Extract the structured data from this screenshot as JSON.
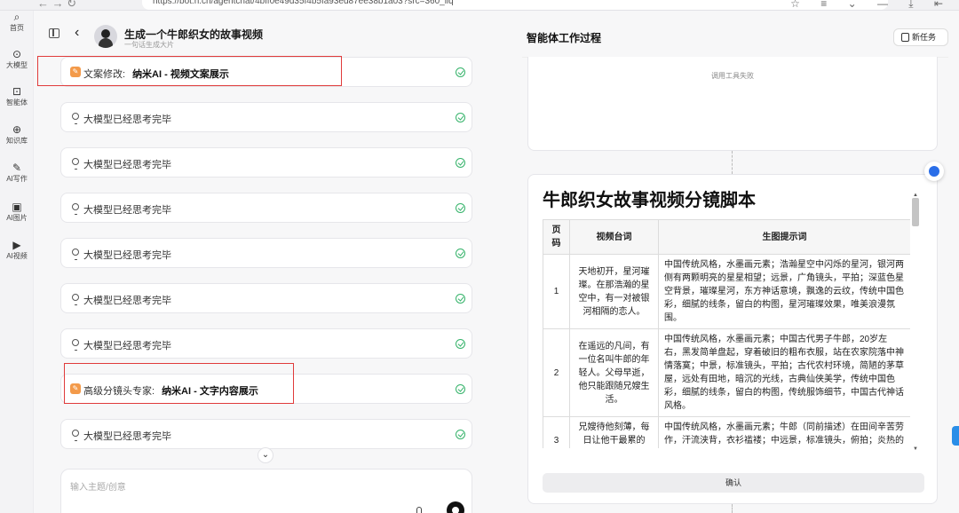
{
  "browser": {
    "nav": "← → ↻",
    "url": "https://bot.n.cn/agentchat/4bff0e49d35f4b5fa93ed87ee38b1a03?src=360_llq",
    "tools": "☆ ≡ ⌄ — ⤓ ⇤"
  },
  "sidebar": {
    "items": [
      {
        "label": "首页",
        "icon": "search-icon",
        "glyph": "⌕"
      },
      {
        "label": "大模型",
        "icon": "model-icon",
        "glyph": "⊙"
      },
      {
        "label": "智能体",
        "icon": "agent-icon",
        "glyph": "⊡"
      },
      {
        "label": "知识库",
        "icon": "knowledge-icon",
        "glyph": "⊕"
      },
      {
        "label": "AI写作",
        "icon": "pen-icon",
        "glyph": "✎"
      },
      {
        "label": "AI图片",
        "icon": "image-icon",
        "glyph": "▣"
      },
      {
        "label": "AI视频",
        "icon": "video-icon",
        "glyph": "▶"
      }
    ]
  },
  "chat": {
    "title": "生成一个牛郎织女的故事视频",
    "subtitle": "一句话生成大片",
    "back": "‹",
    "cards": [
      {
        "type": "tool",
        "prefix": "文案修改:",
        "detail": "纳米AI - 视频文案展示"
      },
      {
        "type": "thinking",
        "text": "大模型已经思考完毕"
      },
      {
        "type": "thinking",
        "text": "大模型已经思考完毕"
      },
      {
        "type": "thinking",
        "text": "大模型已经思考完毕"
      },
      {
        "type": "thinking",
        "text": "大模型已经思考完毕"
      },
      {
        "type": "thinking",
        "text": "大模型已经思考完毕"
      },
      {
        "type": "thinking",
        "text": "大模型已经思考完毕"
      },
      {
        "type": "tool",
        "prefix": "高级分镜头专家:",
        "detail": "纳米AI - 文字内容展示"
      },
      {
        "type": "thinking",
        "text": "大模型已经思考完毕"
      }
    ],
    "scroll_down": "⌄",
    "input_placeholder": "输入主题/创意"
  },
  "work": {
    "title": "智能体工作过程",
    "new_task": "新任务",
    "tool_fail": "调用工具失败",
    "doc_title": "牛郎织女故事视频分镜脚本",
    "table": {
      "headers": [
        "页码",
        "视频台词",
        "生图提示词"
      ],
      "rows": [
        {
          "page": "1",
          "lines": "天地初开，星河璀璨。在那浩瀚的星空中，有一对被银河相隔的恋人。",
          "prompt": "中国传统风格，水墨画元素；浩瀚星空中闪烁的星河，银河两侧有两颗明亮的星星相望；远景，广角镜头，平拍；深蓝色星空背景，璀璨星河，东方神话意境，飘逸的云纹，传统中国色彩，细腻的线条，留白的构图，星河璀璨效果，唯美浪漫氛围。"
        },
        {
          "page": "2",
          "lines": "在遥远的凡间，有一位名叫牛郎的年轻人。父母早逝，他只能跟随兄嫂生活。",
          "prompt": "中国传统风格，水墨画元素；中国古代男子牛郎，20岁左右，黑发简单盘起，穿着破旧的粗布衣服，站在农家院落中神情落寞；中景，标准镜头，平拍；古代农村环境，简陋的茅草屋，远处有田地，暗沉的光线，古典仙侠美学，传统中国色彩，细腻的线条，留白的构图，传统服饰细节，中国古代神话风格。"
        },
        {
          "page": "3",
          "lines": "兄嫂待他刻薄，每日让他干最累的活。",
          "prompt": "中国传统风格，水墨画元素；牛郎（同前描述）在田间辛苦劳作，汗流浃背，衣衫褴褛；中远景，标准镜头，俯拍；炎热的田间，烈日当空。"
        }
      ]
    },
    "scroll_up": "▲",
    "scroll_down": "▼",
    "confirm": "确认"
  }
}
